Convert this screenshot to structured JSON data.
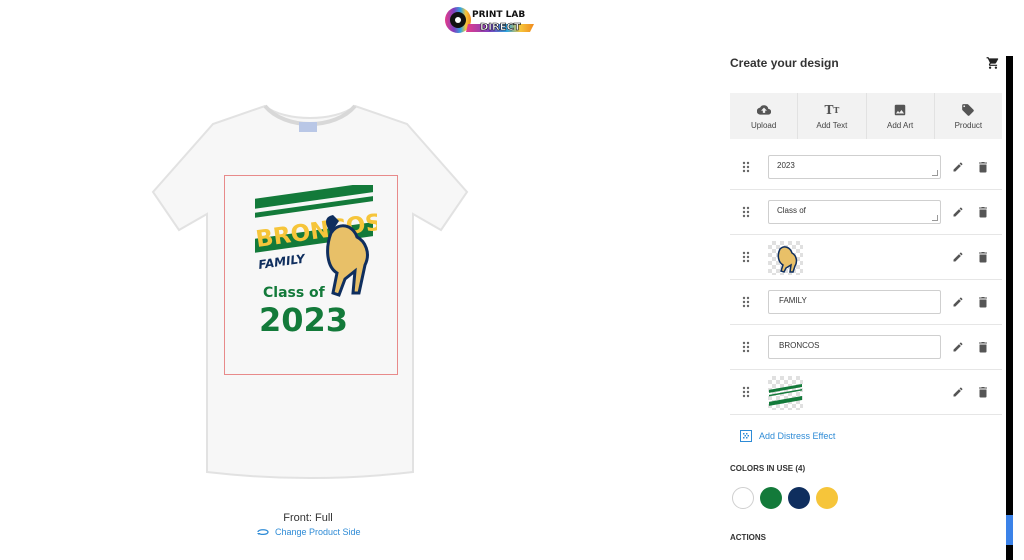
{
  "brand": {
    "logo_line1": "PRINT LAB",
    "logo_line2": "DIRECT"
  },
  "canvas": {
    "side_label": "Front: Full",
    "change_side_label": "Change Product Side",
    "design_text": {
      "line1": "BRONCOS",
      "line2": "FAMILY",
      "line3": "Class of",
      "line4": "2023"
    }
  },
  "panel": {
    "title": "Create your design",
    "tools": [
      {
        "label": "Upload",
        "icon": "cloud-upload-icon"
      },
      {
        "label": "Add Text",
        "icon": "text-icon"
      },
      {
        "label": "Add Art",
        "icon": "image-icon"
      },
      {
        "label": "Product",
        "icon": "tag-icon"
      }
    ],
    "layers": [
      {
        "type": "text",
        "value": "2023"
      },
      {
        "type": "text",
        "value": "Class of"
      },
      {
        "type": "image",
        "value": ""
      },
      {
        "type": "text",
        "value": "FAMILY"
      },
      {
        "type": "text",
        "value": "BRONCOS"
      },
      {
        "type": "image",
        "value": ""
      }
    ],
    "distress_label": "Add Distress Effect",
    "colors_title": "COLORS IN USE (4)",
    "colors": [
      "#ffffff",
      "#137a3a",
      "#0f2e5e",
      "#f6c53a"
    ],
    "actions_title": "ACTIONS"
  }
}
